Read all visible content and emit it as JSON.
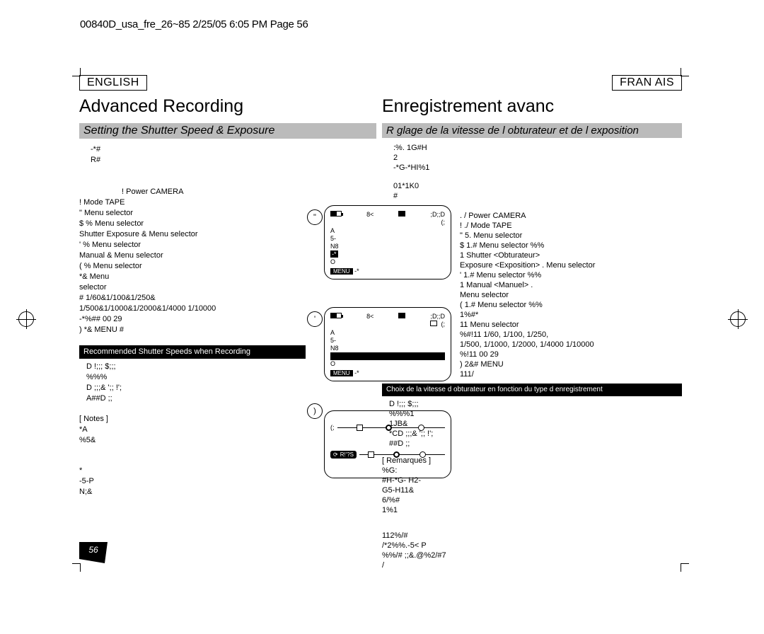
{
  "header_line": "00840D_usa_fre_26~85 2/25/05 6:05 PM Page 56",
  "lang_en": "ENGLISH",
  "lang_fr": "FRAN AIS",
  "title_en": "Advanced Recording",
  "title_fr": "Enregistrement avanc",
  "sub_en": "Setting the Shutter Speed & Exposure",
  "sub_fr": "R glage de la vitesse de l obturateur et de l exposition",
  "intro_en_1": "-*#",
  "intro_en_2": "R#",
  "steps_en_1": "!               Power            CAMERA",
  "steps_en_2": "!               Mode             TAPE",
  "steps_en_3": "\"                  Menu selector",
  "steps_en_4": "$  %            Menu selector",
  "steps_en_5": "  Shutter      Exposure &               Menu selector",
  "steps_en_6": "'  %            Menu selector",
  "steps_en_7": "  Manual &                   Menu selector",
  "steps_en_8": "(  %          Menu selector",
  "steps_en_9": "  *&                                                       Menu",
  "steps_en_10": "   selector",
  "steps_en_11": "      #                             1/60&1/100&1/250&",
  "steps_en_12": "   1/500&1/1000&1/2000&1/4000    1/10000",
  "steps_en_13": "      -*%##                            00     29",
  "steps_en_14": ")  *&                    MENU #",
  "rec_band_en": "Recommended Shutter Speeds when Recording",
  "rec_en_1": "D !;;;  $;;;",
  "rec_en_2": "  %%%",
  "rec_en_3": "D  ;;;& ';;  !';",
  "rec_en_4": "  A##D  ;;",
  "notes_en_title": "[ Notes ]",
  "notes_en_1": "  *A",
  "notes_en_2": "  %5&",
  "notes_en_3": "  *",
  "notes_en_4": "  -5-P",
  "notes_en_5": "  N;&",
  "intro_fr_1": ":%. 1G#H",
  "intro_fr_2": "2",
  "intro_fr_3": "-*G-*HI%1",
  "intro_fr_4": "01*1K0",
  "intro_fr_5": "#",
  "steps_fr_1": ". /                          Power        CAMERA",
  "steps_fr_2": "!  ./                        Mode         TAPE",
  "steps_fr_3": "\"  5.              Menu selector",
  "steps_fr_4": "$  1.#                       Menu selector   %%",
  "steps_fr_5": "     1                              Shutter <Obturateur>",
  "steps_fr_6": "  Exposure <Exposition>    .                Menu selector",
  "steps_fr_7": "'  1.#                       Menu selector   %%",
  "steps_fr_8": "     1                         Manual <Manuel>   .",
  "steps_fr_9": "       Menu selector",
  "steps_fr_10": "(  1.#                     Menu selector   %%",
  "steps_fr_11": "     1%#*",
  "steps_fr_12": "  11                        Menu selector",
  "steps_fr_13": "     %#!11                               1/60, 1/100, 1/250,",
  "steps_fr_14": "    1/500, 1/1000, 1/2000, 1/4000    1/10000",
  "steps_fr_15": "     %!11                                       00    29",
  "steps_fr_16": ")  2&#                                           MENU",
  "steps_fr_17": "       111/",
  "rec_band_fr": "Choix de la vitesse d obturateur en fonction du type d enregistrement",
  "rec_fr_1": "D !;;;  $;;;",
  "rec_fr_2": "  %%%1",
  "rec_fr_3": "  1JB&",
  "rec_fr_4": "  *CD  ;;;& ';;  !';",
  "rec_fr_5": "  ##D  ;;",
  "remarques_title": "[ Remarques ]",
  "rem_fr_1": "  %G:",
  "rem_fr_2": "  #H-*G- H2-",
  "rem_fr_3": "  G5-H11&",
  "rem_fr_4": "  6/%#",
  "rem_fr_5": "  1%1",
  "foot_fr_1": "112%/#",
  "foot_fr_2": "/*2%%.-5< P",
  "foot_fr_3": "%%/# ;;&.@%2/#7",
  "foot_fr_4": "/",
  "lcd": {
    "stby": "8<",
    "time": ";D;;D",
    "mode": "(;",
    "l1": "A",
    "l2": "5-",
    "l3": "N8",
    "l4": "-*",
    "l5": "O",
    "menu": "MENU",
    "menu_after": "-*",
    "shutter_pill": "R!'?S"
  },
  "page_num": "56"
}
